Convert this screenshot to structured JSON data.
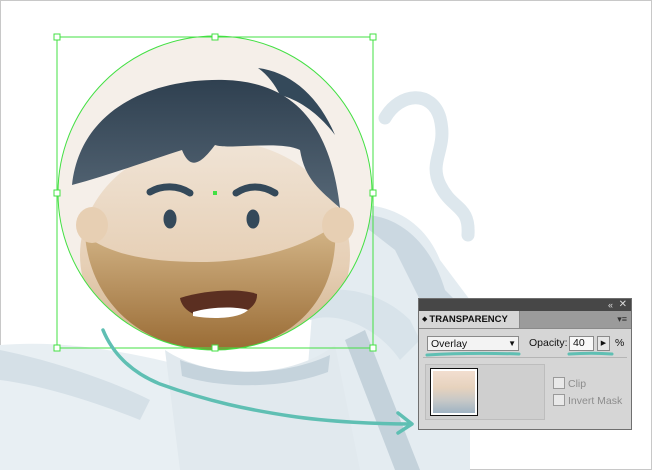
{
  "panel": {
    "title": "TRANSPARENCY",
    "collapse_icon": "«",
    "close_icon": "✕",
    "menu_icon": "▾≡",
    "blend_mode": "Overlay",
    "opacity_label": "Opacity:",
    "opacity_value": "40",
    "percent": "%",
    "checkboxes": [
      {
        "label": "Clip",
        "checked": false
      },
      {
        "label": "Invert Mask",
        "checked": false
      }
    ]
  },
  "colors": {
    "selection": "#43e043",
    "annotation": "#5fbfb3",
    "hair": "#34495a",
    "skin": "#ecdccb",
    "beard": "#b08550",
    "suit": "#dce6ec"
  }
}
